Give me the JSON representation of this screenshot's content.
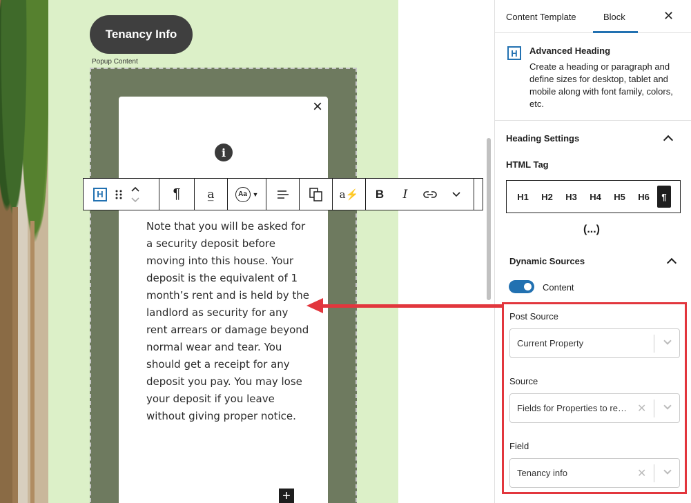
{
  "canvas": {
    "button_label": "Tenancy Info",
    "popup_label": "Popup Content",
    "popup_text": "Note that you will be asked for a security deposit before moving into this house. Your deposit is the equivalent of 1 month’s rent and is held by the landlord as security for any rent arrears or damage beyond normal wear and tear. You should get a receipt for any deposit you pay. You may lose your deposit if you leave without giving proper notice."
  },
  "toolbar": {
    "block_type_label": "H",
    "paragraph_symbol": "¶",
    "font_size_label": "Aa",
    "bold_label": "B",
    "italic_label": "I"
  },
  "sidebar": {
    "tabs": [
      {
        "label": "Content Template"
      },
      {
        "label": "Block",
        "active": true
      }
    ],
    "close_label": "✕",
    "block": {
      "icon_label": "H",
      "title": "Advanced Heading",
      "description": "Create a heading or paragraph and define sizes for desktop, tablet and mobile along with font family, colors, etc."
    },
    "heading_settings": {
      "title": "Heading Settings",
      "html_tag_label": "HTML Tag",
      "tags": [
        "H1",
        "H2",
        "H3",
        "H4",
        "H5",
        "H6",
        "¶"
      ],
      "active_tag": "¶",
      "ellipsis": "(...)"
    },
    "dynamic_sources": {
      "title": "Dynamic Sources",
      "toggle_label": "Content",
      "toggle_on": true,
      "post_source": {
        "label": "Post Source",
        "value": "Current Property"
      },
      "source": {
        "label": "Source",
        "value": "Fields for Properties to re…"
      },
      "field": {
        "label": "Field",
        "value": "Tenancy info"
      }
    }
  },
  "colors": {
    "accent": "#2271b1",
    "annotation": "#e2363d",
    "canvas_bg": "#dcf0c8",
    "popup_frame": "#6e7a5f"
  }
}
